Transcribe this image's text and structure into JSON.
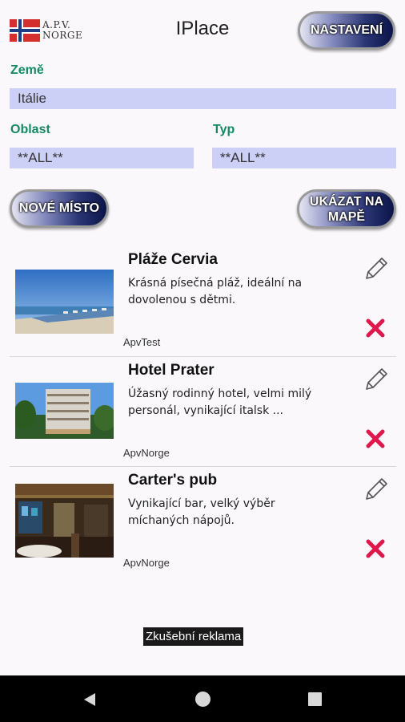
{
  "header": {
    "logo_text_line1": "A.P.V.",
    "logo_text_line2": "NORGE",
    "title": "IPlace",
    "settings_label": "NASTAVENÍ"
  },
  "filters": {
    "country_label": "Země",
    "country_value": "Itálie",
    "region_label": "Oblast",
    "region_value": "**ALL**",
    "type_label": "Typ",
    "type_value": "**ALL**"
  },
  "actions": {
    "new_place_label": "NOVÉ MÍSTO",
    "show_map_line1": "UKÁZAT NA",
    "show_map_line2": "MAPĚ"
  },
  "places": [
    {
      "title": "Pláže Cervia",
      "description": "Krásná písečná pláž, ideální na dovolenou s dětmi.",
      "author": "ApvTest"
    },
    {
      "title": "Hotel Prater",
      "description": "Úžasný rodinný hotel, velmi milý personál, vynikající italsk ...",
      "author": "ApvNorge"
    },
    {
      "title": "Carter's pub",
      "description": "Vynikající bar, velký výběr míchaných nápojů.",
      "author": "ApvNorge"
    }
  ],
  "ad_label": "Zkušební reklama",
  "colors": {
    "label_green": "#138a63",
    "field_bg": "#ccd0f6",
    "delete_red": "#e0174c",
    "button_dark": "#0b1549"
  },
  "icons": {
    "edit": "pencil-icon",
    "delete": "delete-x-icon",
    "nav_back": "back-triangle-icon",
    "nav_home": "home-circle-icon",
    "nav_recent": "recent-square-icon"
  }
}
